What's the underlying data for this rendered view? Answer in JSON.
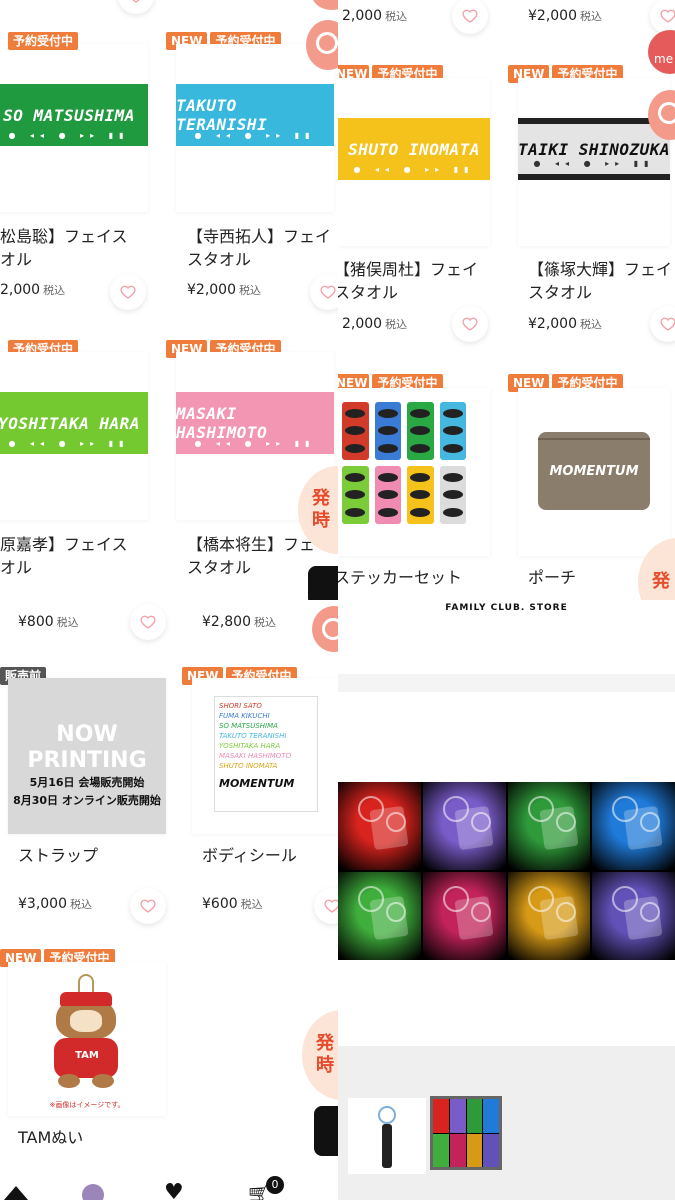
{
  "badges": {
    "new": "NEW",
    "preorder": "予約受付中",
    "before_sale": "販売前"
  },
  "tax_label": "税込",
  "panel_left_top": {
    "items": [
      {
        "name_line1": "松島聡】フェイス",
        "name_line2": "オル",
        "price": "2,000",
        "towel_text": "SO MATSUSHIMA",
        "color": "#1f9a3e"
      },
      {
        "name_line1": "【寺西拓人】フェイ",
        "name_line2": "スタオル",
        "price": "¥2,000",
        "towel_text": "TAKUTO TERANISHI",
        "color": "#39b8de"
      },
      {
        "name_line1": "原嘉孝】フェイス",
        "name_line2": "オル",
        "price": "2,000",
        "towel_text": "YOSHITAKA HARA",
        "color": "#74c931"
      },
      {
        "name_line1": "【橋本将生】フェイ",
        "name_line2": "スタオル",
        "price": "¥2,000",
        "towel_text": "MASAKI HASHIMOTO",
        "color": "#f296b4"
      }
    ],
    "float_badge": "発\n時"
  },
  "panel_right_top": {
    "top_prices": [
      "2,000",
      "¥2,000"
    ],
    "items": [
      {
        "name_line1": "【猪俣周杜】フェイ",
        "name_line2": "スタオル",
        "price": "2,000",
        "towel_text": "SHUTO INOMATA",
        "color": "#f4c21a"
      },
      {
        "name_line1": "【篠塚大輝】フェイ",
        "name_line2": "スタオル",
        "price": "¥2,000",
        "towel_text": "TAIKI SHINOZUKA",
        "color": "#d0d0d0"
      },
      {
        "name_line1": "ステッカーセット",
        "name_line2": "",
        "price": "",
        "towel_text": "",
        "color": ""
      },
      {
        "name_line1": "ポーチ",
        "name_line2": "",
        "price": "",
        "towel_text": "",
        "color": ""
      }
    ],
    "pouch_text": "MOMENTUM",
    "footer_brand": "FAMILY CLUB. STORE",
    "float_label": "me",
    "float_badge": "発"
  },
  "panel_left_bottom": {
    "top_prices": [
      "¥800",
      "¥2,800"
    ],
    "items": [
      {
        "name": "ストラップ",
        "price": "¥3,000",
        "now_printing_1": "NOW",
        "now_printing_2": "PRINTING",
        "note_1": "5月16日 会場販売開始",
        "note_2": "8月30日 オンライン販売開始"
      },
      {
        "name": "ボディシール",
        "price": "¥600"
      },
      {
        "name": "TAMぬい",
        "price": "",
        "plush_text": "TAM",
        "image_note": "※画像はイメージです。"
      }
    ],
    "sheet_names": [
      "SHORI SATO",
      "FUMA KIKUCHI",
      "SO MATSUSHIMA",
      "TAKUTO TERANISHI",
      "YOSHITAKA HARA",
      "MASAKI HASHIMOTO",
      "SHUTO INOMATA"
    ],
    "sheet_logo": "MOMENTUM",
    "cart_count": "0",
    "float_badge": "発\n時"
  },
  "panel_right_bottom": {
    "light_colors": [
      "#d8231e",
      "#7a5cc9",
      "#2f9a3a",
      "#1f7ad8",
      "#3fae3c",
      "#c2235a",
      "#d69a17",
      "#6252b8"
    ]
  },
  "colors": {
    "accent": "#f07c3c",
    "heart": "#f4a0a8",
    "float": "#f49a8b"
  }
}
